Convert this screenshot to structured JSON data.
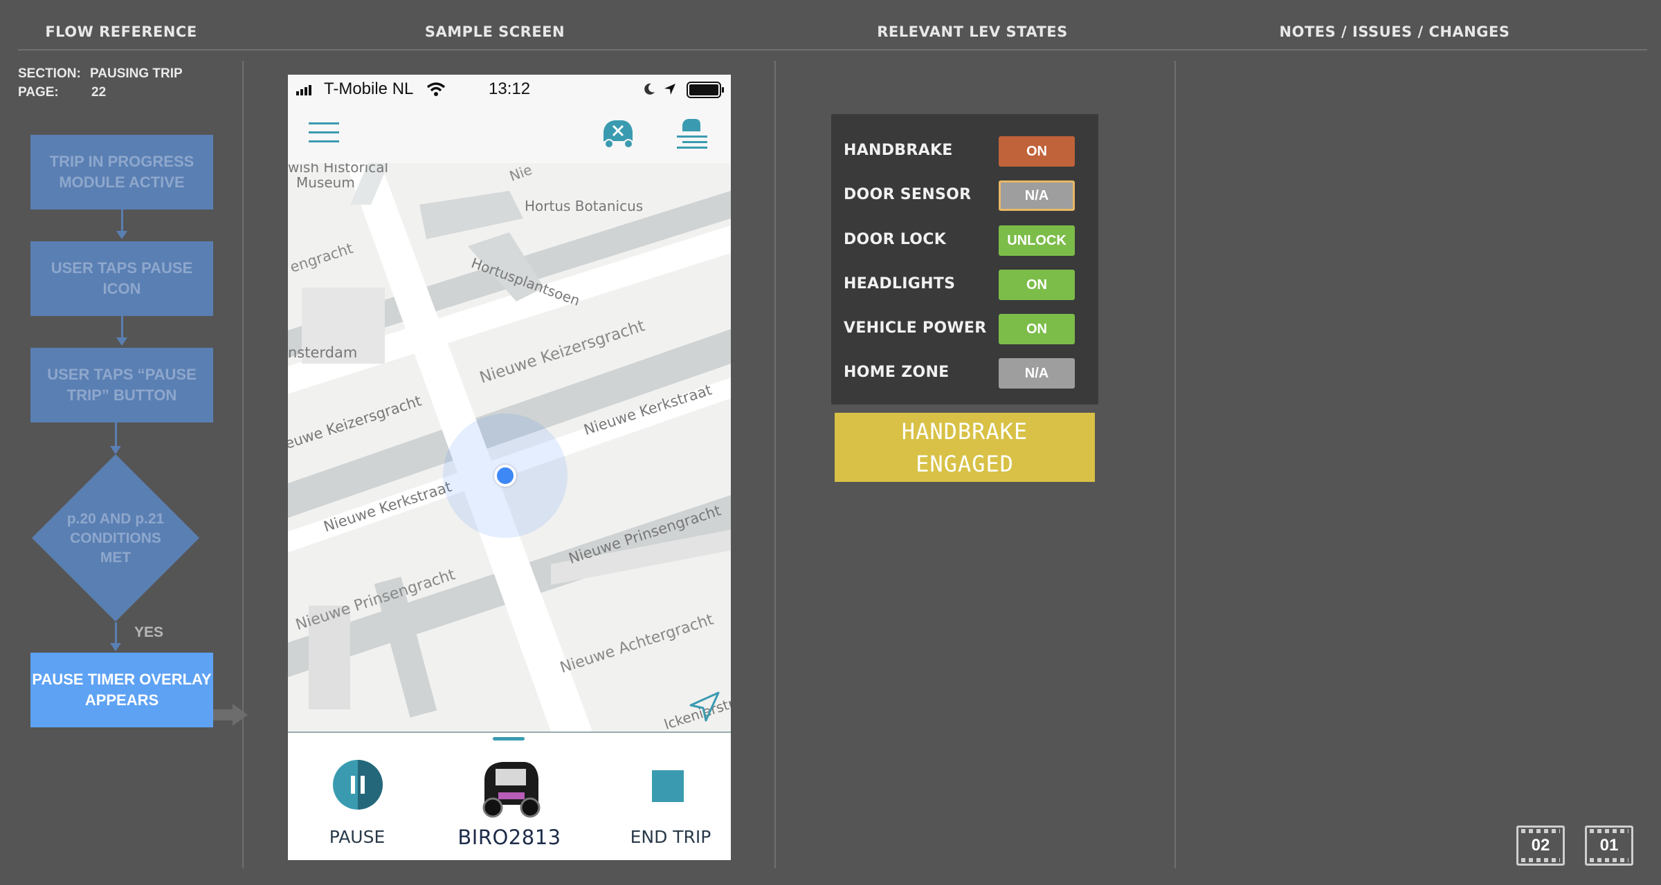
{
  "headers": {
    "flow": "FLOW REFERENCE",
    "sample": "SAMPLE SCREEN",
    "states": "RELEVANT LEV STATES",
    "notes": "NOTES / ISSUES / CHANGES"
  },
  "meta": {
    "section_label": "SECTION:",
    "section_value": "PAUSING TRIP",
    "page_label": "PAGE:",
    "page_value": "22"
  },
  "flow": {
    "steps": [
      "TRIP IN PROGRESS MODULE ACTIVE",
      "USER TAPS PAUSE ICON",
      "USER TAPS “PAUSE TRIP” BUTTON"
    ],
    "decision": "p.20 AND p.21 CONDITIONS MET",
    "yes_label": "YES",
    "result": "PAUSE TIMER OVERLAY APPEARS"
  },
  "phone": {
    "status": {
      "carrier": "T-Mobile NL",
      "time": "13:12"
    },
    "map_labels": {
      "museum_line1": "wish Historical",
      "museum_line2": "Museum",
      "nie_top": "Nie",
      "hortus": "Hortus Botanicus",
      "hortusplantsoen": "Hortusplantsoen",
      "engracht": "engracht",
      "keizersgracht_top": "Nieuwe Keizersgracht",
      "amsterdam": "nsterdam",
      "keizersgracht_left": "euwe Keizersgracht",
      "kerkstraat_right": "Nieuwe Kerkstraat",
      "kerkstraat_left": "Nieuwe Kerkstraat",
      "prinsengracht_right": "Nieuwe Prinsengracht",
      "prinsengracht_left": "Nieuwe Prinsengracht",
      "achtergracht": "Nieuwe Achtergracht",
      "kenier": "lckenierstra"
    },
    "bottom": {
      "pause_label": "PAUSE",
      "vehicle_id": "BIRO2813",
      "end_label": "END TRIP"
    }
  },
  "lev_states": [
    {
      "label": "HANDBRAKE",
      "value": "ON",
      "color": "#c0623a"
    },
    {
      "label": "DOOR SENSOR",
      "value": "N/A",
      "color": "#9e9e9e"
    },
    {
      "label": "DOOR LOCK",
      "value": "UNLOCK",
      "color": "#7cbd4a"
    },
    {
      "label": "HEADLIGHTS",
      "value": "ON",
      "color": "#7cbd4a"
    },
    {
      "label": "VEHICLE POWER",
      "value": "ON",
      "color": "#7cbd4a"
    },
    {
      "label": "HOME ZONE",
      "value": "N/A",
      "color": "#9e9e9e"
    }
  ],
  "alert": {
    "line1": "HANDBRAKE",
    "line2": "ENGAGED",
    "color": "#d8c146"
  },
  "footer_nav": {
    "btn_a": "02",
    "btn_b": "01"
  },
  "colors": {
    "accent": "#3a9bb0",
    "flow_box": "#5a7fb3",
    "flow_active": "#5ea2f4",
    "location_dot": "#3d88f5"
  },
  "icons": [
    "menu-icon",
    "car-service-icon",
    "car-list-icon",
    "signal-icon",
    "wifi-icon",
    "moon-icon",
    "location-arrow-icon",
    "battery-icon",
    "navigate-icon",
    "pause-icon",
    "stop-icon"
  ]
}
